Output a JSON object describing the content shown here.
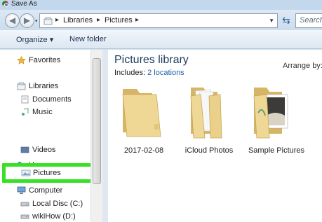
{
  "window": {
    "title": "Save As"
  },
  "address": {
    "segments": [
      "Libraries",
      "Pictures"
    ],
    "search_placeholder": "Search"
  },
  "toolbar": {
    "organize_label": "Organize ▾",
    "new_folder_label": "New folder"
  },
  "nav": {
    "favorites": "Favorites",
    "libraries": "Libraries",
    "documents": "Documents",
    "music": "Music",
    "pictures": "Pictures",
    "videos": "Videos",
    "homegroup": "Homegroup",
    "computer": "Computer",
    "local_disc": "Local Disc (C:)",
    "wikihow": "wikiHow (D:)"
  },
  "content": {
    "title": "Pictures library",
    "includes_label": "Includes:",
    "includes_link": "2 locations",
    "arrange_label": "Arrange by:",
    "folders": [
      "2017-02-08",
      "iCloud Photos",
      "Sample Pictures"
    ]
  },
  "colors": {
    "highlight": "#38e126",
    "folder": "#e8cf8e",
    "link": "#1b5eb0"
  }
}
